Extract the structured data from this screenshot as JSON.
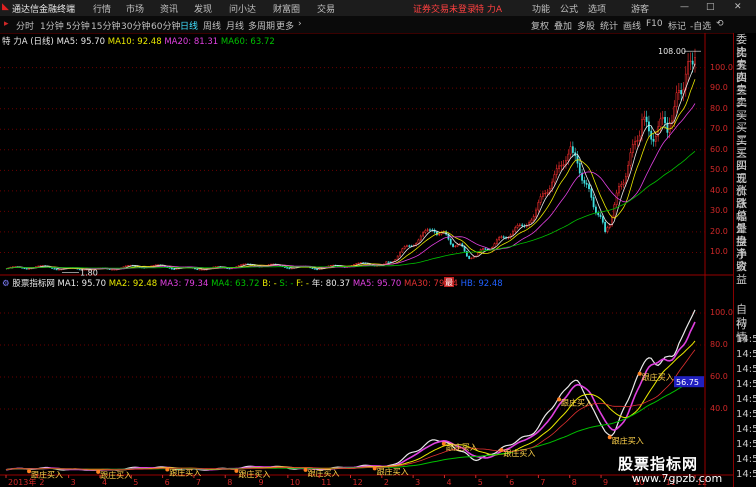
{
  "app": {
    "title": "通达信金融终端",
    "menu": [
      "行情",
      "市场",
      "资讯",
      "发现",
      "问小达",
      "财富圈",
      "交易"
    ],
    "login_status": "证券交易未登录",
    "featured": "特 力A",
    "right_menu": [
      "功能",
      "公式",
      "选项"
    ],
    "user": "游客",
    "window_controls": [
      "—",
      "□",
      "✕"
    ]
  },
  "toolbar": {
    "periods": [
      "分时",
      "1分钟",
      "5分钟",
      "15分钟",
      "30分钟",
      "60分钟",
      "日线",
      "周线",
      "月线",
      "多周期",
      "更多"
    ],
    "active_period": "日线",
    "tools": [
      "复权",
      "叠加",
      "多股",
      "统计",
      "画线",
      "F10",
      "标记",
      "-自选"
    ]
  },
  "stock": {
    "name": "特 力A",
    "period": "(日线)",
    "ma": [
      {
        "label": "MA5: 95.70",
        "color": "#e8e8e8"
      },
      {
        "label": "MA10: 92.48",
        "color": "#e8e800"
      },
      {
        "label": "MA20: 81.31",
        "color": "#e040e0"
      },
      {
        "label": "MA60: 63.72",
        "color": "#00c000"
      }
    ],
    "high_label": "108.00",
    "low_label": "1.80",
    "y_ticks": [
      "100.0",
      "90.0",
      "80.0",
      "70.0",
      "60.0",
      "50.0",
      "40.0",
      "30.0",
      "20.0",
      "10.0"
    ],
    "marker": "最"
  },
  "indicator": {
    "name": "股票指标网",
    "values": [
      {
        "label": "MA1: 95.70",
        "color": "#e8e8e8"
      },
      {
        "label": "MA2: 92.48",
        "color": "#e8e800"
      },
      {
        "label": "MA3: 79.34",
        "color": "#e040e0"
      },
      {
        "label": "MA4: 63.72",
        "color": "#00c000"
      },
      {
        "label": "B: -",
        "color": "#e8e800"
      },
      {
        "label": "S: -",
        "color": "#00c000"
      },
      {
        "label": "F: -",
        "color": "#e8e800"
      },
      {
        "label": "年: 80.37",
        "color": "#e8e8e8"
      },
      {
        "label": "MA5: 95.70",
        "color": "#e040e0"
      },
      {
        "label": "MA30: 79.34",
        "color": "#e03030"
      },
      {
        "label": "HB: 92.48",
        "color": "#2060ff"
      }
    ],
    "y_ticks": [
      "100.0",
      "80.0",
      "60.0",
      "40.0"
    ],
    "value_tag": "56.75",
    "signal_label": "跟庄买入"
  },
  "side_panel": {
    "top_items": [
      "委比",
      "卖五",
      "卖四",
      "卖三",
      "卖二",
      "卖一",
      "买一",
      "买二",
      "买三",
      "买四",
      "买五",
      "现价",
      "涨跌",
      "涨幅",
      "总量",
      "外盘",
      "换手",
      "净资",
      "收益"
    ],
    "bottom_items": [
      "自动",
      "行情",
      "14:50",
      "14:50",
      "14:50",
      "14:50",
      "14:50",
      "14:50",
      "14:50",
      "14:50",
      "14:50",
      "14:50"
    ]
  },
  "x_axis": {
    "labels": [
      "2013年",
      "2",
      "3",
      "4",
      "5",
      "6",
      "7",
      "8",
      "9",
      "10",
      "11",
      "12",
      "2",
      "3",
      "4",
      "5",
      "6",
      "7",
      "8",
      "9",
      "10",
      "11",
      "12"
    ]
  },
  "watermark": {
    "line1": "股票指标网",
    "line2": "www.7gpzb.com"
  },
  "colors": {
    "up": "#ff3030",
    "down": "#40e0e0",
    "grid": "#7a0000",
    "accent": "#d02828"
  }
}
